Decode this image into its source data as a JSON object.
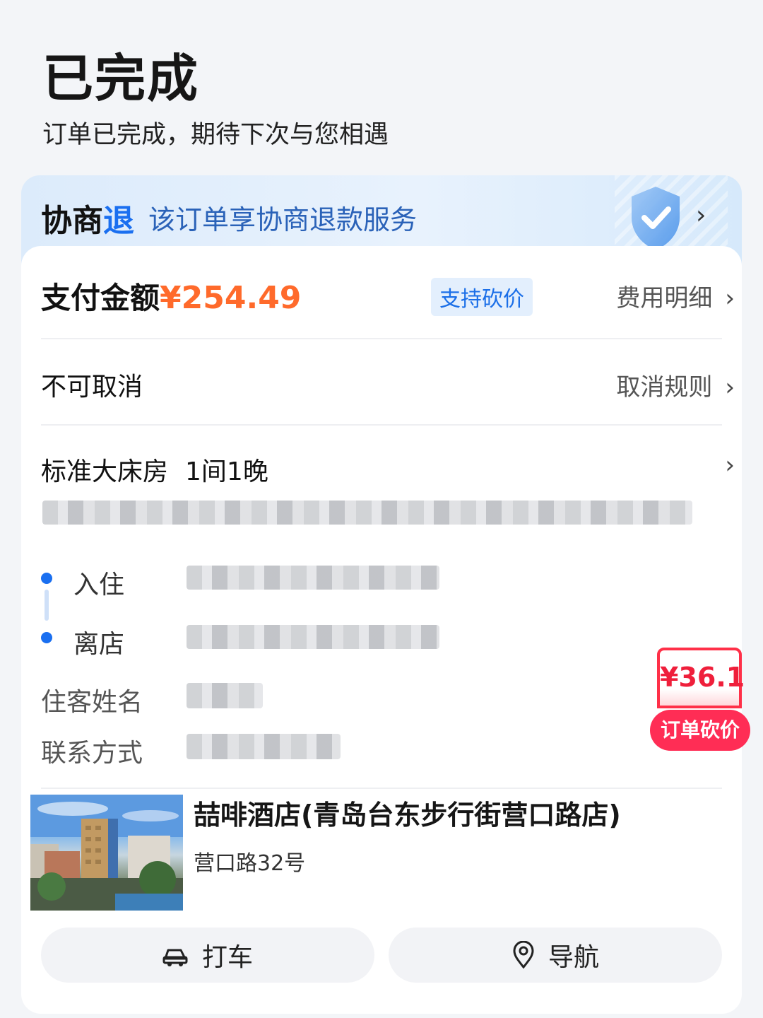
{
  "status": {
    "title": "已完成",
    "subtitle": "订单已完成，期待下次与您相遇"
  },
  "banner": {
    "title_prefix": "协商",
    "title_accent": "退",
    "description": "该订单享协商退款服务",
    "icon": "shield-check-icon"
  },
  "payment": {
    "label": "支付金额",
    "amount": "¥254.49",
    "tag": "支持砍价",
    "link": "费用明细"
  },
  "cancel": {
    "label": "不可取消",
    "link": "取消规则"
  },
  "room": {
    "type": "标准大床房",
    "count": "1间1晚"
  },
  "stay": {
    "checkin_label": "入住",
    "checkout_label": "离店",
    "guest_label": "住客姓名",
    "contact_label": "联系方式"
  },
  "bargain_badge": {
    "amount": "¥36.1",
    "label": "订单砍价"
  },
  "hotel": {
    "name": "喆啡酒店(青岛台东步行街营口路店)",
    "address": "营口路32号"
  },
  "actions": {
    "taxi_label": "打车",
    "taxi_icon": "car-icon",
    "navigate_label": "导航",
    "navigate_icon": "location-pin-icon"
  },
  "colors": {
    "accent_blue": "#1a6ff0",
    "price_orange": "#ff6a2b",
    "badge_red": "#ff2d55"
  }
}
